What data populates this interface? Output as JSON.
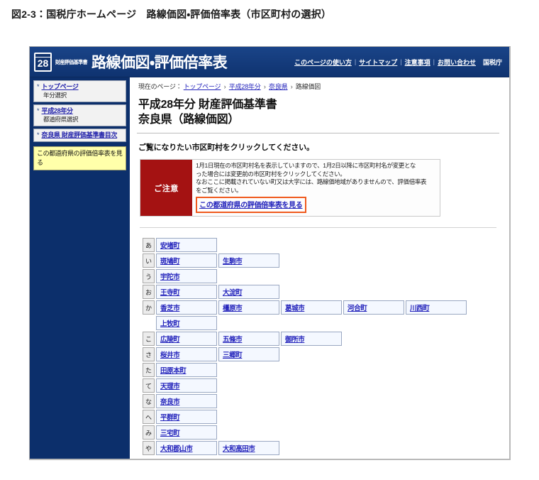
{
  "figure": {
    "caption": "図2-3：国税庁ホームページ　路線価図・評価倍率表（市区町村の選択）"
  },
  "header": {
    "logo_year": "28",
    "brand_sub": "財産評価基準書",
    "brand_main": "路線価図・評価倍率表",
    "nav": [
      {
        "label": "このページの使い方"
      },
      {
        "label": "サイトマップ"
      },
      {
        "label": "注意事項"
      },
      {
        "label": "お問い合わせ"
      }
    ],
    "separator": "|",
    "agency": "国税庁"
  },
  "sidebar": {
    "items": [
      {
        "bullet": "*",
        "link": "トップページ",
        "sub": "年分選択"
      },
      {
        "bullet": "*",
        "link": "平成28年分",
        "sub": "都道府県選択"
      },
      {
        "bullet": "*",
        "link": "奈良県 財産評価基準書目次",
        "sub": ""
      }
    ],
    "note_link": "この都道府県の評価倍率表を見る"
  },
  "breadcrumb": {
    "prefix": "現在のページ：",
    "arrow": "›",
    "items": [
      {
        "label": "トップページ",
        "is_link": true
      },
      {
        "label": "平成28年分",
        "is_link": true
      },
      {
        "label": "奈良県",
        "is_link": true
      },
      {
        "label": "路線価図",
        "is_link": false
      }
    ]
  },
  "main": {
    "title_line1": "平成28年分 財産評価基準書",
    "title_line2": "奈良県（路線価図）",
    "instruction": "ご覧になりたい市区町村をクリックしてください。"
  },
  "notice": {
    "label": "ご注意",
    "line1": "1月1日現在の市区町村名を表示していますので、1月2日以降に市区町村名が変更とな",
    "line2": "った場合には変更前の市区町村をクリックしてください。",
    "line3": "なおここに掲載されていない町又は大字には、路線価地域がありませんので、評価倍率表",
    "line4": "をご覧ください。",
    "link": "この都道府県の評価倍率表を見る",
    "accent_border": "#f05a1e",
    "label_bg": "#a41212"
  },
  "municipality_table": {
    "rows": [
      {
        "kana": "あ",
        "cities": [
          "安堵町"
        ]
      },
      {
        "kana": "い",
        "cities": [
          "斑鳩町",
          "生駒市"
        ]
      },
      {
        "kana": "う",
        "cities": [
          "宇陀市"
        ]
      },
      {
        "kana": "お",
        "cities": [
          "王寺町",
          "大淀町"
        ]
      },
      {
        "kana": "か",
        "cities": [
          "香芝市",
          "橿原市",
          "葛城市",
          "河合町",
          "川西町"
        ]
      },
      {
        "kana": "",
        "cities": [
          "上牧町"
        ]
      },
      {
        "kana": "こ",
        "cities": [
          "広陵町",
          "五條市",
          "御所市"
        ]
      },
      {
        "kana": "さ",
        "cities": [
          "桜井市",
          "三郷町"
        ]
      },
      {
        "kana": "た",
        "cities": [
          "田原本町"
        ]
      },
      {
        "kana": "て",
        "cities": [
          "天理市"
        ]
      },
      {
        "kana": "な",
        "cities": [
          "奈良市"
        ]
      },
      {
        "kana": "へ",
        "cities": [
          "平群町"
        ]
      },
      {
        "kana": "み",
        "cities": [
          "三宅町"
        ]
      },
      {
        "kana": "や",
        "cities": [
          "大和郡山市",
          "大和高田市"
        ]
      }
    ]
  },
  "colors": {
    "header_blue": "#123a76",
    "sidebar_blue": "#0c2f6b",
    "note_yellow": "#ffffaa",
    "link_blue": "#2222bb"
  }
}
